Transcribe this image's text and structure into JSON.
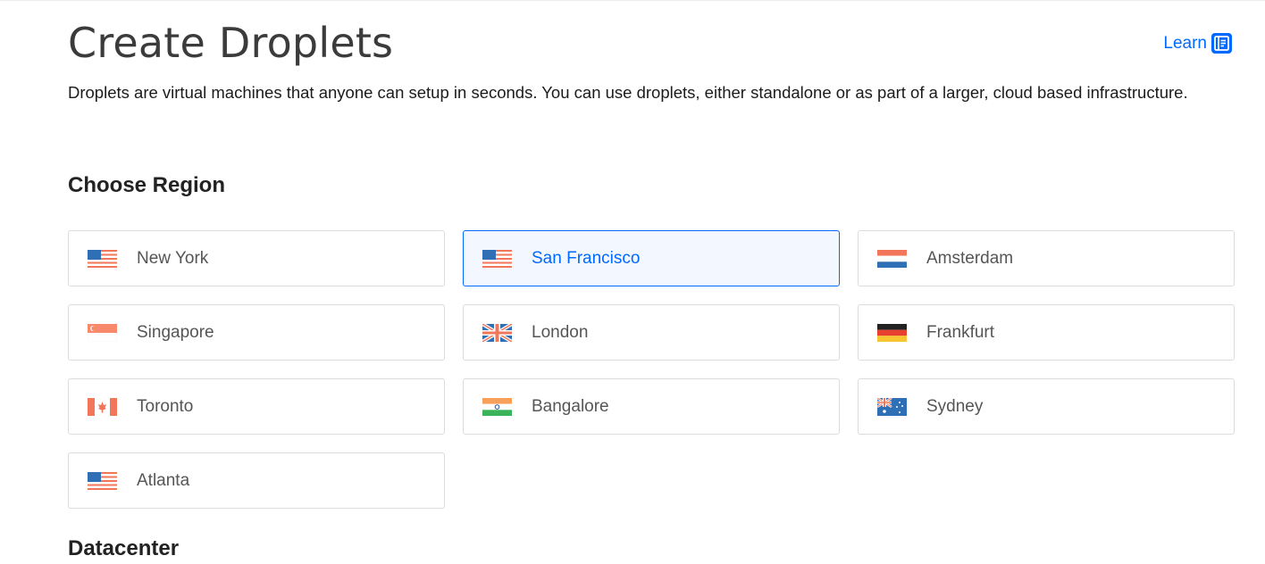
{
  "header": {
    "title": "Create Droplets",
    "learn_label": "Learn",
    "learn_icon": "doc-icon",
    "accent": "#0069ff"
  },
  "intro": "Droplets are virtual machines that anyone can setup in seconds. You can use droplets, either standalone or as part of a larger, cloud based infrastructure.",
  "region": {
    "title": "Choose Region",
    "selected": "San Francisco",
    "items": [
      {
        "label": "New York",
        "flag": "us-flag-icon"
      },
      {
        "label": "San Francisco",
        "flag": "us-flag-icon"
      },
      {
        "label": "Amsterdam",
        "flag": "netherlands-flag-icon"
      },
      {
        "label": "Singapore",
        "flag": "singapore-flag-icon"
      },
      {
        "label": "London",
        "flag": "uk-flag-icon"
      },
      {
        "label": "Frankfurt",
        "flag": "germany-flag-icon"
      },
      {
        "label": "Toronto",
        "flag": "canada-flag-icon"
      },
      {
        "label": "Bangalore",
        "flag": "india-flag-icon"
      },
      {
        "label": "Sydney",
        "flag": "australia-flag-icon"
      },
      {
        "label": "Atlanta",
        "flag": "us-flag-icon"
      }
    ]
  },
  "datacenter": {
    "title": "Datacenter"
  }
}
